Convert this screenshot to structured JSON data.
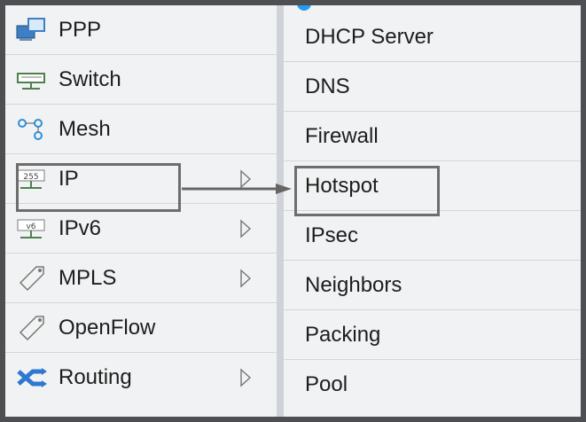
{
  "left_menu": {
    "items": [
      {
        "label": "PPP",
        "icon": "ppp-icon"
      },
      {
        "label": "Switch",
        "icon": "switch-icon"
      },
      {
        "label": "Mesh",
        "icon": "mesh-icon"
      },
      {
        "label": "IP",
        "icon": "ip-icon"
      },
      {
        "label": "IPv6",
        "icon": "ipv6-icon"
      },
      {
        "label": "MPLS",
        "icon": "mpls-icon"
      },
      {
        "label": "OpenFlow",
        "icon": "openflow-icon"
      },
      {
        "label": "Routing",
        "icon": "routing-icon"
      }
    ]
  },
  "right_menu": {
    "items": [
      {
        "label": "DHCP Server"
      },
      {
        "label": "DNS"
      },
      {
        "label": "Firewall"
      },
      {
        "label": "Hotspot"
      },
      {
        "label": "IPsec"
      },
      {
        "label": "Neighbors"
      },
      {
        "label": "Packing"
      },
      {
        "label": "Pool"
      }
    ]
  },
  "colors": {
    "accent": "#1f9ff2",
    "highlight_border": "#6d6d6d",
    "menu_bg": "#f1f2f3"
  }
}
